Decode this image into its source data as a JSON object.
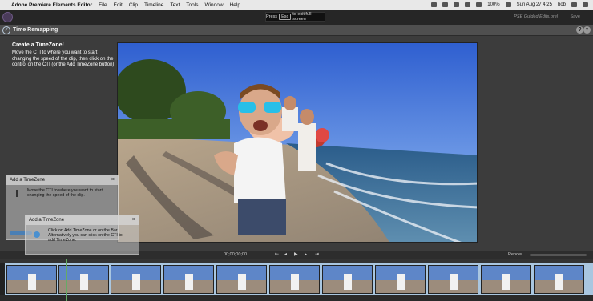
{
  "menubar": {
    "app_name": "Adobe Premiere Elements Editor",
    "menus": [
      "File",
      "Edit",
      "Clip",
      "Timeline",
      "Text",
      "Tools",
      "Window",
      "Help"
    ],
    "status": {
      "battery": "100%",
      "clock": "Sun Aug 27  4:25",
      "user": "bob"
    }
  },
  "titlebar": {
    "fullscreen_hint_before": "Press",
    "fullscreen_hint_key": "Esc",
    "fullscreen_hint_after": "to exit full screen",
    "project_name": "PSE Guided Edits.prel",
    "save_label": "Save"
  },
  "panel": {
    "title": "Time Remapping",
    "help_label": "?",
    "close_label": "×"
  },
  "instructions": {
    "heading": "Create a TimeZone!",
    "body": "Move the CTI to where you want to start changing the speed of the clip, then click on the control on the CTI (or the Add TimeZone button)"
  },
  "transport": {
    "timecode": "00;00;00;00",
    "render_label": "Render"
  },
  "dialog_primary": {
    "title": "Add a TimeZone",
    "close": "×",
    "text": "Move the CTI to where you want to start changing the speed of the clip."
  },
  "dialog_secondary": {
    "title": "Add a TimeZone",
    "close": "×",
    "text_a": "Click on  Add TimeZone  or  on the Bar",
    "text_b": "Alternatively you can click on the CTI to",
    "text_c": "add TimeZone."
  },
  "colors": {
    "panel_bg": "#3c3c3c",
    "track_bg": "#a9c6e0",
    "accent": "#4a90d0"
  }
}
